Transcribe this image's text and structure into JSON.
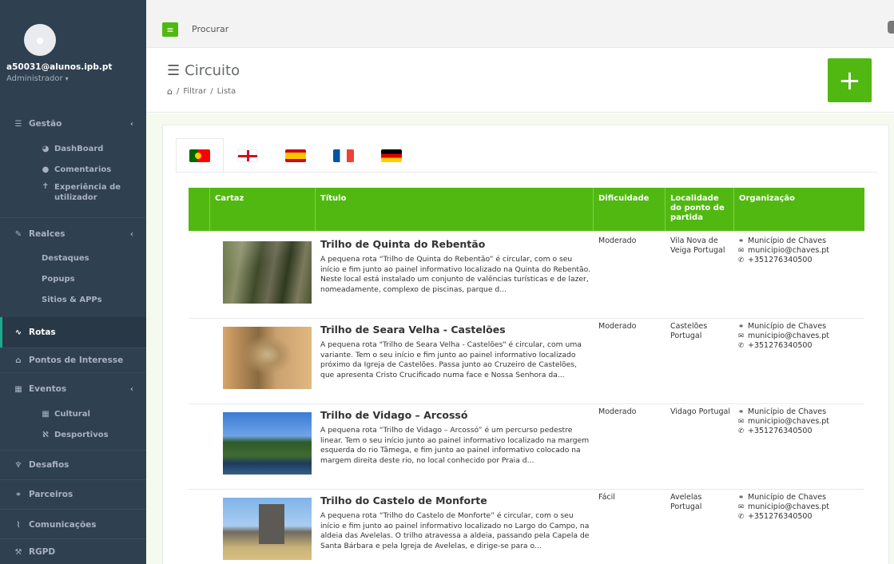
{
  "user": {
    "email": "a50031@alunos.ipb.pt",
    "role": "Administrador"
  },
  "sidebar": {
    "items": [
      {
        "label": "Gestão"
      },
      {
        "label": "DashBoard"
      },
      {
        "label": "Comentarios"
      },
      {
        "label": "Experiência de utilizador"
      },
      {
        "label": "Realces"
      },
      {
        "label": "Destaques"
      },
      {
        "label": "Popups"
      },
      {
        "label": "Sitios & APPs"
      },
      {
        "label": "Rotas"
      },
      {
        "label": "Pontos de Interesse"
      },
      {
        "label": "Eventos"
      },
      {
        "label": "Cultural"
      },
      {
        "label": "Desportivos"
      },
      {
        "label": "Desafios"
      },
      {
        "label": "Parceiros"
      },
      {
        "label": "Comunicações"
      },
      {
        "label": "RGPD"
      }
    ]
  },
  "topbar": {
    "search_placeholder": "Procurar"
  },
  "page": {
    "title": "Circuito",
    "breadcrumb": [
      "Filtrar",
      "Lista"
    ]
  },
  "table": {
    "headers": [
      "Cartaz",
      "Título",
      "Dificuldade",
      "Localidade do ponto de partida",
      "Organização"
    ],
    "rows": [
      {
        "title": "Trilho de Quinta do Rebentão",
        "desc": "A pequena rota “Trilho de Quinta do Rebentão” é circular, com o seu início e fim junto ao painel informativo localizado na Quinta do Rebentão. Neste local está instalado um conjunto de valências turísticas e de lazer, nomeadamente, complexo de piscinas, parque d...",
        "difficulty": "Moderado",
        "location": "Vila Nova de Veiga Portugal",
        "org_name": "Município de Chaves",
        "org_email": "municipio@chaves.pt",
        "org_phone": "+351276340500"
      },
      {
        "title": "Trilho de Seara Velha - Castelões",
        "desc": "A pequena rota \"Trilho de Seara Velha - Castelões\" é circular, com uma variante. Tem o seu início e fim junto ao painel informativo localizado próximo da Igreja de Castelões. Passa junto ao Cruzeiro de Castelões, que apresenta Cristo Crucificado numa face e Nossa Senhora da...",
        "difficulty": "Moderado",
        "location": "Castelões Portugal",
        "org_name": "Município de Chaves",
        "org_email": "municipio@chaves.pt",
        "org_phone": "+351276340500"
      },
      {
        "title": "Trilho de Vidago – Arcossó",
        "desc": "A pequena rota “Trilho de Vidago – Arcossó” é um percurso pedestre linear. Tem o seu início junto ao painel informativo localizado na margem esquerda do rio Tâmega, e fim junto ao painel informativo colocado na margem direita deste rio, no local conhecido por Praia d...",
        "difficulty": "Moderado",
        "location": "Vidago Portugal",
        "org_name": "Município de Chaves",
        "org_email": "municipio@chaves.pt",
        "org_phone": "+351276340500"
      },
      {
        "title": "Trilho do Castelo de Monforte",
        "desc": "A pequena rota “Trilho do Castelo de Monforte” é circular, com o seu início e fim junto ao painel informativo localizado no Largo do Campo, na aldeia das Avelelas. O trilho atravessa a aldeia, passando pela Capela de Santa Bárbara e pela Igreja de Avelelas, e dirige-se para o...",
        "difficulty": "Fácil",
        "location": "Avelelas Portugal",
        "org_name": "Município de Chaves",
        "org_email": "municipio@chaves.pt",
        "org_phone": "+351276340500"
      }
    ]
  },
  "colors": {
    "accent": "#51b811",
    "sidebar": "#2f4050",
    "active_border": "#19aa8d"
  }
}
